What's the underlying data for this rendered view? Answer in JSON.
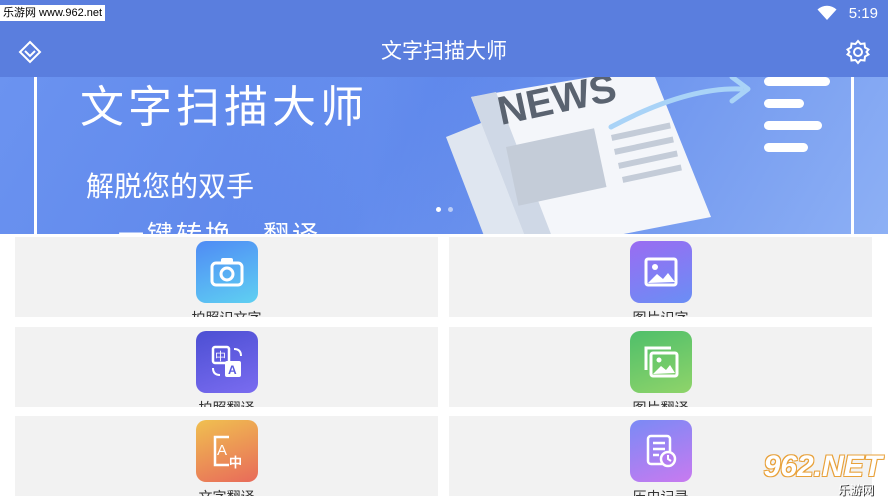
{
  "status_bar": {
    "watermark": "乐游网 www.962.net",
    "time": "5:19",
    "icons": [
      "wifi-icon",
      "battery-icon"
    ]
  },
  "app_bar": {
    "title": "文字扫描大师",
    "left_icon": "diamond-chevron-icon",
    "right_icon": "gear-icon"
  },
  "banner": {
    "title": "文字扫描大师",
    "subtitle": "解脱您的双手",
    "subtitle2": "一键转换，翻译",
    "art_text": "NEWS",
    "page_count": 2,
    "active_page": 1
  },
  "features": [
    {
      "label": "拍照识文字",
      "icon": "camera-icon",
      "color_from": "#4f8bf5",
      "color_to": "#5fd0f2"
    },
    {
      "label": "图片识字",
      "icon": "image-icon",
      "color_from": "#9a6cf2",
      "color_to": "#6a8ef5"
    },
    {
      "label": "拍照翻译",
      "icon": "translate-icon",
      "color_from": "#4c4fd3",
      "color_to": "#7a6cf0"
    },
    {
      "label": "图片翻译",
      "icon": "gallery-icon",
      "color_from": "#4fbf6a",
      "color_to": "#8fd46a"
    },
    {
      "label": "文字翻译",
      "icon": "text-translate-icon",
      "color_from": "#f0c050",
      "color_to": "#e86a5a"
    },
    {
      "label": "历史记录",
      "icon": "history-icon",
      "color_from": "#7a8af5",
      "color_to": "#c87af0"
    }
  ],
  "logo": {
    "text": "962.NET",
    "sub": "乐游网"
  },
  "colors": {
    "primary": "#5a7ede",
    "card_bg": "#f2f2f2"
  }
}
